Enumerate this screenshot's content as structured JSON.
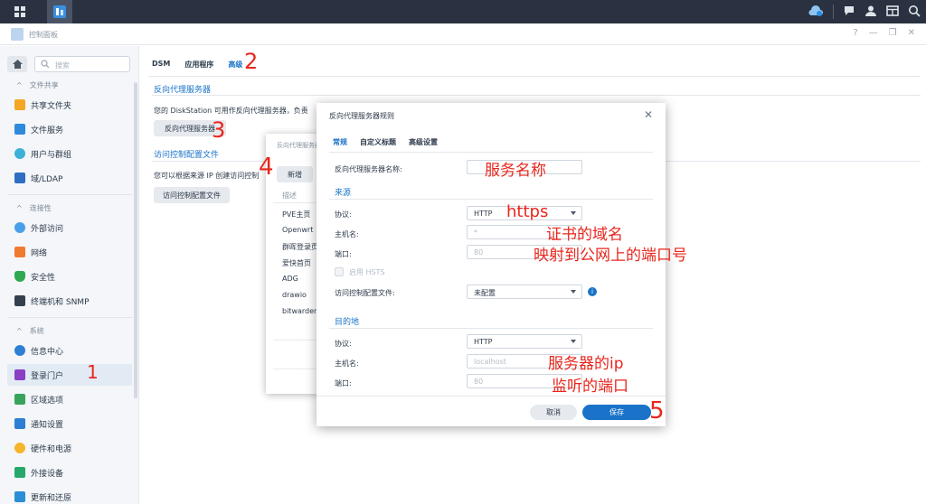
{
  "window": {
    "title": "控制面板",
    "controls": [
      "?",
      "—",
      "❐",
      "✕"
    ]
  },
  "sidebar": {
    "search_placeholder": "搜索",
    "sections": [
      {
        "label": "文件共享"
      },
      {
        "label": "连接性"
      },
      {
        "label": "系统"
      }
    ],
    "items": [
      {
        "label": "共享文件夹",
        "color": "#f5a623"
      },
      {
        "label": "文件服务",
        "color": "#2e8bdc"
      },
      {
        "label": "用户与群组",
        "color": "#3db2d8"
      },
      {
        "label": "域/LDAP",
        "color": "#2e6fc1"
      },
      {
        "label": "外部访问",
        "color": "#4aa0e8"
      },
      {
        "label": "网络",
        "color": "#f07a30"
      },
      {
        "label": "安全性",
        "color": "#2fa84f"
      },
      {
        "label": "终端机和 SNMP",
        "color": "#35404e"
      },
      {
        "label": "信息中心",
        "color": "#2e7fd6"
      },
      {
        "label": "登录门户",
        "color": "#8a3fc4"
      },
      {
        "label": "区域选项",
        "color": "#38a35a"
      },
      {
        "label": "通知设置",
        "color": "#2d7fd4"
      },
      {
        "label": "硬件和电源",
        "color": "#f5b62a"
      },
      {
        "label": "外接设备",
        "color": "#27a86a"
      },
      {
        "label": "更新和还原",
        "color": "#2a8fd6"
      }
    ]
  },
  "main": {
    "tabs": [
      "DSM",
      "应用程序",
      "高级"
    ],
    "reverse_proxy": {
      "heading": "反向代理服务器",
      "desc": "您的 DiskStation 可用作反向代理服务器，负责",
      "button": "反向代理服务器"
    },
    "access_control": {
      "heading": "访问控制配置文件",
      "desc": "您可以根据来源 IP 创建访问控制",
      "button": "访问控制配置文件"
    }
  },
  "bg_dialog": {
    "title": "反向代理服务器",
    "new_button": "新增",
    "column": "描述",
    "rows": [
      "PVE主页",
      "Openwrt",
      "群晖登录页",
      "爱快首页",
      "ADG",
      "drawio",
      "bitwarden"
    ]
  },
  "dialog": {
    "title": "反向代理服务器规则",
    "tabs": [
      "常规",
      "自定义标题",
      "高级设置"
    ],
    "name_label": "反向代理服务器名称:",
    "source": {
      "heading": "来源",
      "protocol_label": "协议:",
      "protocol_value": "HTTP",
      "host_label": "主机名:",
      "host_placeholder": "*",
      "port_label": "端口:",
      "port_placeholder": "80",
      "hsts_label": "启用 HSTS",
      "acl_label": "访问控制配置文件:",
      "acl_value": "未配置"
    },
    "destination": {
      "heading": "目的地",
      "protocol_label": "协议:",
      "protocol_value": "HTTP",
      "host_label": "主机名:",
      "host_placeholder": "localhost",
      "port_label": "端口:",
      "port_placeholder": "80"
    },
    "cancel": "取消",
    "save": "保存"
  },
  "annotations": {
    "n1": "1",
    "n2": "2",
    "n3": "3",
    "n4": "4",
    "n5": "5",
    "service_name": "服务名称",
    "https": "https",
    "cert_domain": "证书的域名",
    "public_port": "映射到公网上的端口号",
    "server_ip": "服务器的ip",
    "listen_port": "监听的端口"
  }
}
